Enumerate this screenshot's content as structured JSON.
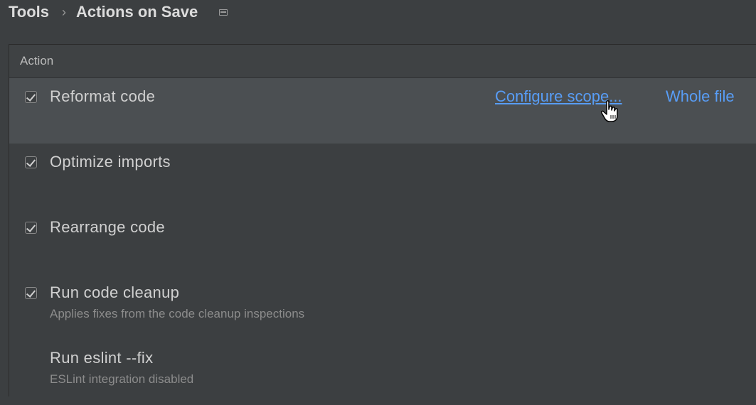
{
  "breadcrumb": {
    "parent": "Tools",
    "separator": "›",
    "current": "Actions on Save",
    "window_icon": "window-icon"
  },
  "table": {
    "header": "Action",
    "rows": [
      {
        "label": "Reformat code",
        "checked": true,
        "description": "",
        "configure_link": "Configure scope...",
        "scope_link": "Whole file"
      },
      {
        "label": "Optimize imports",
        "checked": true,
        "description": ""
      },
      {
        "label": "Rearrange code",
        "checked": true,
        "description": ""
      },
      {
        "label": "Run code cleanup",
        "checked": true,
        "description": "Applies fixes from the code cleanup inspections"
      },
      {
        "label": "Run eslint --fix",
        "checked": false,
        "description": "ESLint integration disabled"
      }
    ]
  },
  "colors": {
    "link": "#589df6",
    "selected_row": "#4b4f52",
    "background": "#3c3f41"
  }
}
